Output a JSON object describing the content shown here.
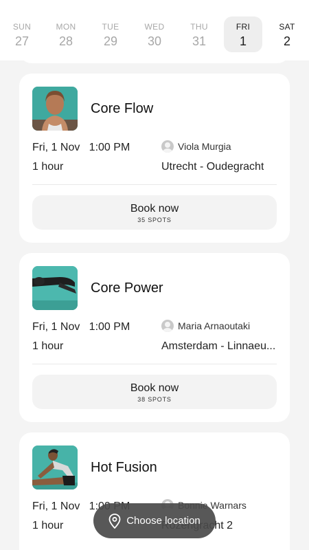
{
  "days": [
    {
      "dow": "SUN",
      "num": "27"
    },
    {
      "dow": "MON",
      "num": "28"
    },
    {
      "dow": "TUE",
      "num": "29"
    },
    {
      "dow": "WED",
      "num": "30"
    },
    {
      "dow": "THU",
      "num": "31"
    },
    {
      "dow": "FRI",
      "num": "1"
    },
    {
      "dow": "SAT",
      "num": "2"
    }
  ],
  "selected_day": "FRI",
  "classes": [
    {
      "title": "Core Flow",
      "date": "Fri, 1 Nov   1:00 PM",
      "duration": "1 hour",
      "instructor": "Viola Murgia",
      "location": "Utrecht - Oudegracht",
      "book_label": "Book now",
      "spots": "35 SPOTS",
      "thumbnail": "portrait-woman-smiling"
    },
    {
      "title": "Core Power",
      "date": "Fri, 1 Nov   1:00 PM",
      "duration": "1 hour",
      "instructor": "Maria Arnaoutaki",
      "location": "Amsterdam - Linnaeu...",
      "book_label": "Book now",
      "spots": "38 SPOTS",
      "thumbnail": "plank-pose"
    },
    {
      "title": "Hot Fusion",
      "date": "Fri, 1 Nov   1:00 PM",
      "duration": "1 hour",
      "instructor": "Bonnie Warnars",
      "location": "Rozengracht 2",
      "thumbnail": "seated-stretch"
    }
  ],
  "location_pill": {
    "label": "Choose location",
    "icon": "map-pin-icon"
  },
  "colors": {
    "teal": "#4cb3aa",
    "background": "#f4f4f4",
    "pill": "#4a4a4a"
  }
}
